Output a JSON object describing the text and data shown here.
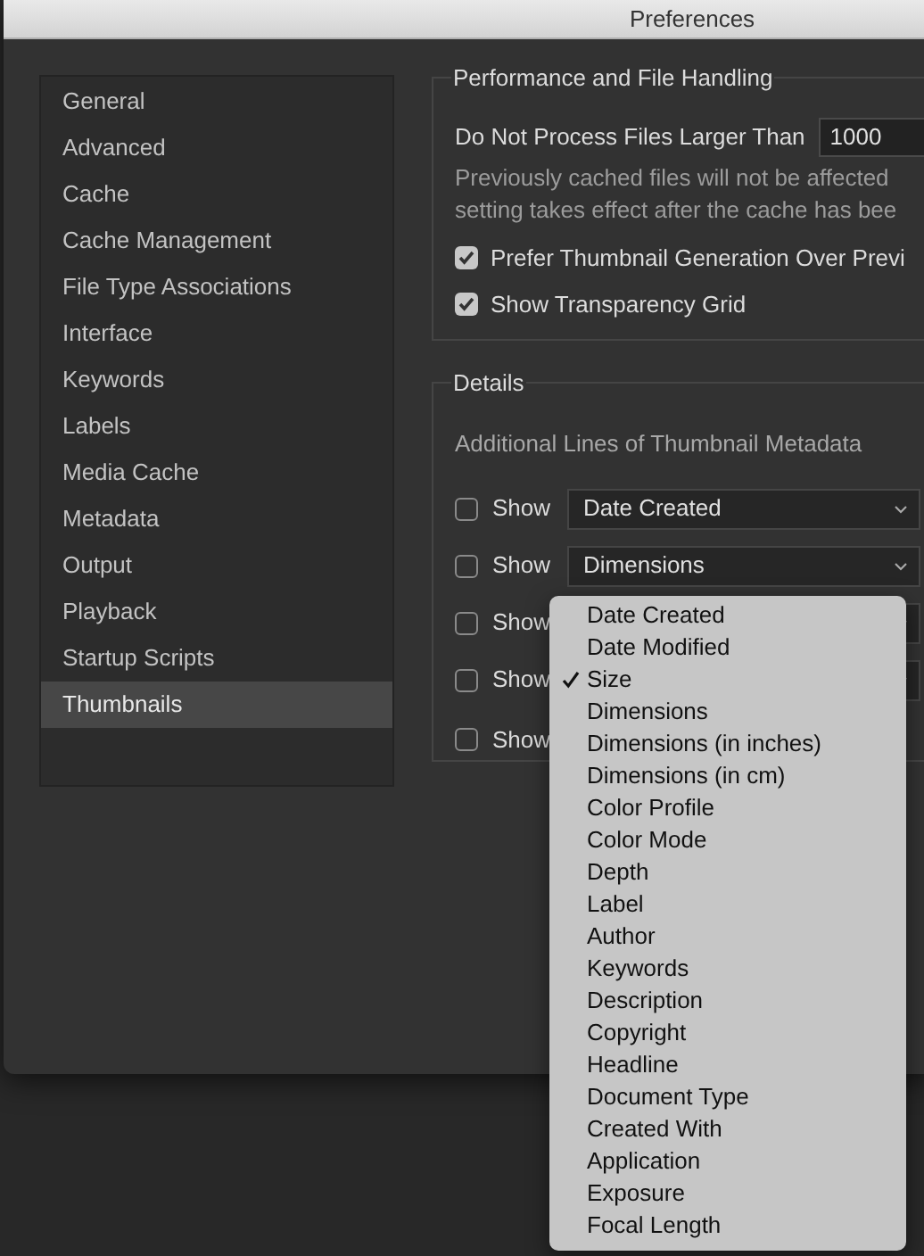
{
  "window": {
    "title": "Preferences"
  },
  "sidebar": {
    "items": [
      {
        "label": "General",
        "selected": false
      },
      {
        "label": "Advanced",
        "selected": false
      },
      {
        "label": "Cache",
        "selected": false
      },
      {
        "label": "Cache Management",
        "selected": false
      },
      {
        "label": "File Type Associations",
        "selected": false
      },
      {
        "label": "Interface",
        "selected": false
      },
      {
        "label": "Keywords",
        "selected": false
      },
      {
        "label": "Labels",
        "selected": false
      },
      {
        "label": "Media Cache",
        "selected": false
      },
      {
        "label": "Metadata",
        "selected": false
      },
      {
        "label": "Output",
        "selected": false
      },
      {
        "label": "Playback",
        "selected": false
      },
      {
        "label": "Startup Scripts",
        "selected": false
      },
      {
        "label": "Thumbnails",
        "selected": true
      }
    ]
  },
  "performance": {
    "title": "Performance and File Handling",
    "size_label": "Do Not Process Files Larger Than",
    "size_value": "1000",
    "note": [
      "Previously cached files will not be affected",
      "setting takes effect after the cache has bee"
    ],
    "options": [
      {
        "label": "Prefer Thumbnail Generation Over Previ",
        "checked": true
      },
      {
        "label": "Show Transparency Grid",
        "checked": true
      }
    ]
  },
  "details": {
    "title": "Details",
    "subtitle": "Additional Lines of Thumbnail Metadata",
    "rows": [
      {
        "label": "Show",
        "checked": false,
        "kind": "select",
        "value": "Date Created"
      },
      {
        "label": "Show",
        "checked": false,
        "kind": "select",
        "value": "Dimensions"
      },
      {
        "label": "Show",
        "checked": false,
        "kind": "select"
      },
      {
        "label": "Show",
        "checked": false,
        "kind": "select"
      },
      {
        "label": "Show",
        "checked": false,
        "kind": "plain"
      }
    ]
  },
  "menu": {
    "items": [
      {
        "label": "Date Created",
        "selected": false
      },
      {
        "label": "Date Modified",
        "selected": false
      },
      {
        "label": "Size",
        "selected": true
      },
      {
        "label": "Dimensions",
        "selected": false
      },
      {
        "label": "Dimensions (in inches)",
        "selected": false
      },
      {
        "label": "Dimensions (in cm)",
        "selected": false
      },
      {
        "label": "Color Profile",
        "selected": false
      },
      {
        "label": "Color Mode",
        "selected": false
      },
      {
        "label": "Depth",
        "selected": false
      },
      {
        "label": "Label",
        "selected": false
      },
      {
        "label": "Author",
        "selected": false
      },
      {
        "label": "Keywords",
        "selected": false
      },
      {
        "label": "Description",
        "selected": false
      },
      {
        "label": "Copyright",
        "selected": false
      },
      {
        "label": "Headline",
        "selected": false
      },
      {
        "label": "Document Type",
        "selected": false
      },
      {
        "label": "Created With",
        "selected": false
      },
      {
        "label": "Application",
        "selected": false
      },
      {
        "label": "Exposure",
        "selected": false
      },
      {
        "label": "Focal Length",
        "selected": false
      }
    ]
  }
}
